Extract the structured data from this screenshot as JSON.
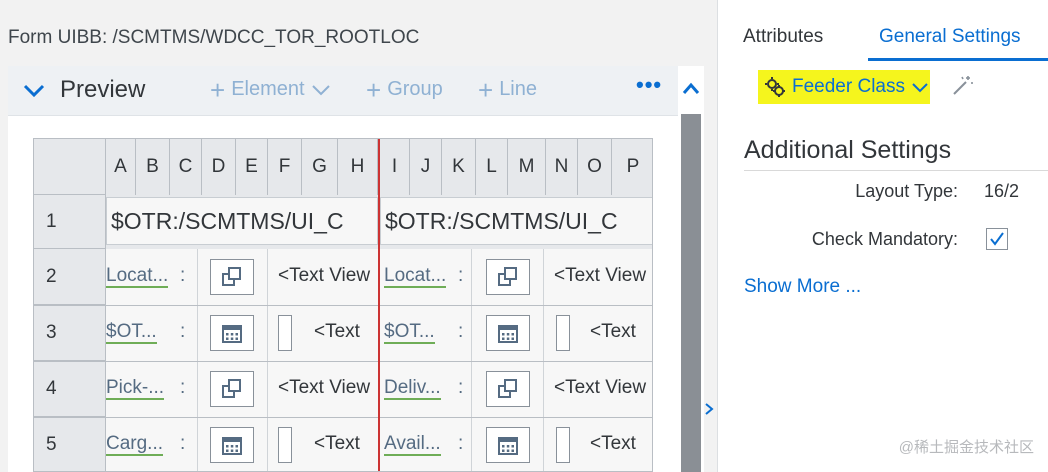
{
  "form_title": "Form UIBB: /SCMTMS/WDCC_TOR_ROOTLOC",
  "preview": {
    "title": "Preview",
    "toolbar": {
      "element_label": "Element",
      "group_label": "Group",
      "line_label": "Line",
      "more_label": "•••"
    }
  },
  "grid": {
    "columns": [
      "A",
      "B",
      "C",
      "D",
      "E",
      "F",
      "G",
      "H",
      "I",
      "J",
      "K",
      "L",
      "M",
      "N",
      "O",
      "P"
    ],
    "rows": [
      "1",
      "2",
      "3",
      "4",
      "5"
    ],
    "row1": {
      "left_text": "$OTR:/SCMTMS/UI_C",
      "right_text": "$OTR:/SCMTMS/UI_C"
    },
    "left_labels": [
      "Locat...",
      "$OT...",
      "Pick-...",
      "Carg..."
    ],
    "right_labels": [
      "Locat...",
      "$OT...",
      "Deliv...",
      "Avail..."
    ],
    "colon": ":",
    "text_view_long": "<Text View",
    "text_view_short": "<Text"
  },
  "right_panel": {
    "tabs": {
      "attributes": "Attributes",
      "general_settings": "General Settings"
    },
    "feeder_class": "Feeder Class",
    "additional_settings": "Additional Settings",
    "layout_type_label": "Layout Type:",
    "layout_type_value": "16/2",
    "check_mandatory_label": "Check Mandatory:",
    "check_mandatory_checked": true,
    "show_more": "Show More ..."
  },
  "watermark": "@稀土掘金技术社区",
  "colors": {
    "accent": "#0a6ed1",
    "highlight": "#f5f51d",
    "separator": "#cc3333"
  }
}
